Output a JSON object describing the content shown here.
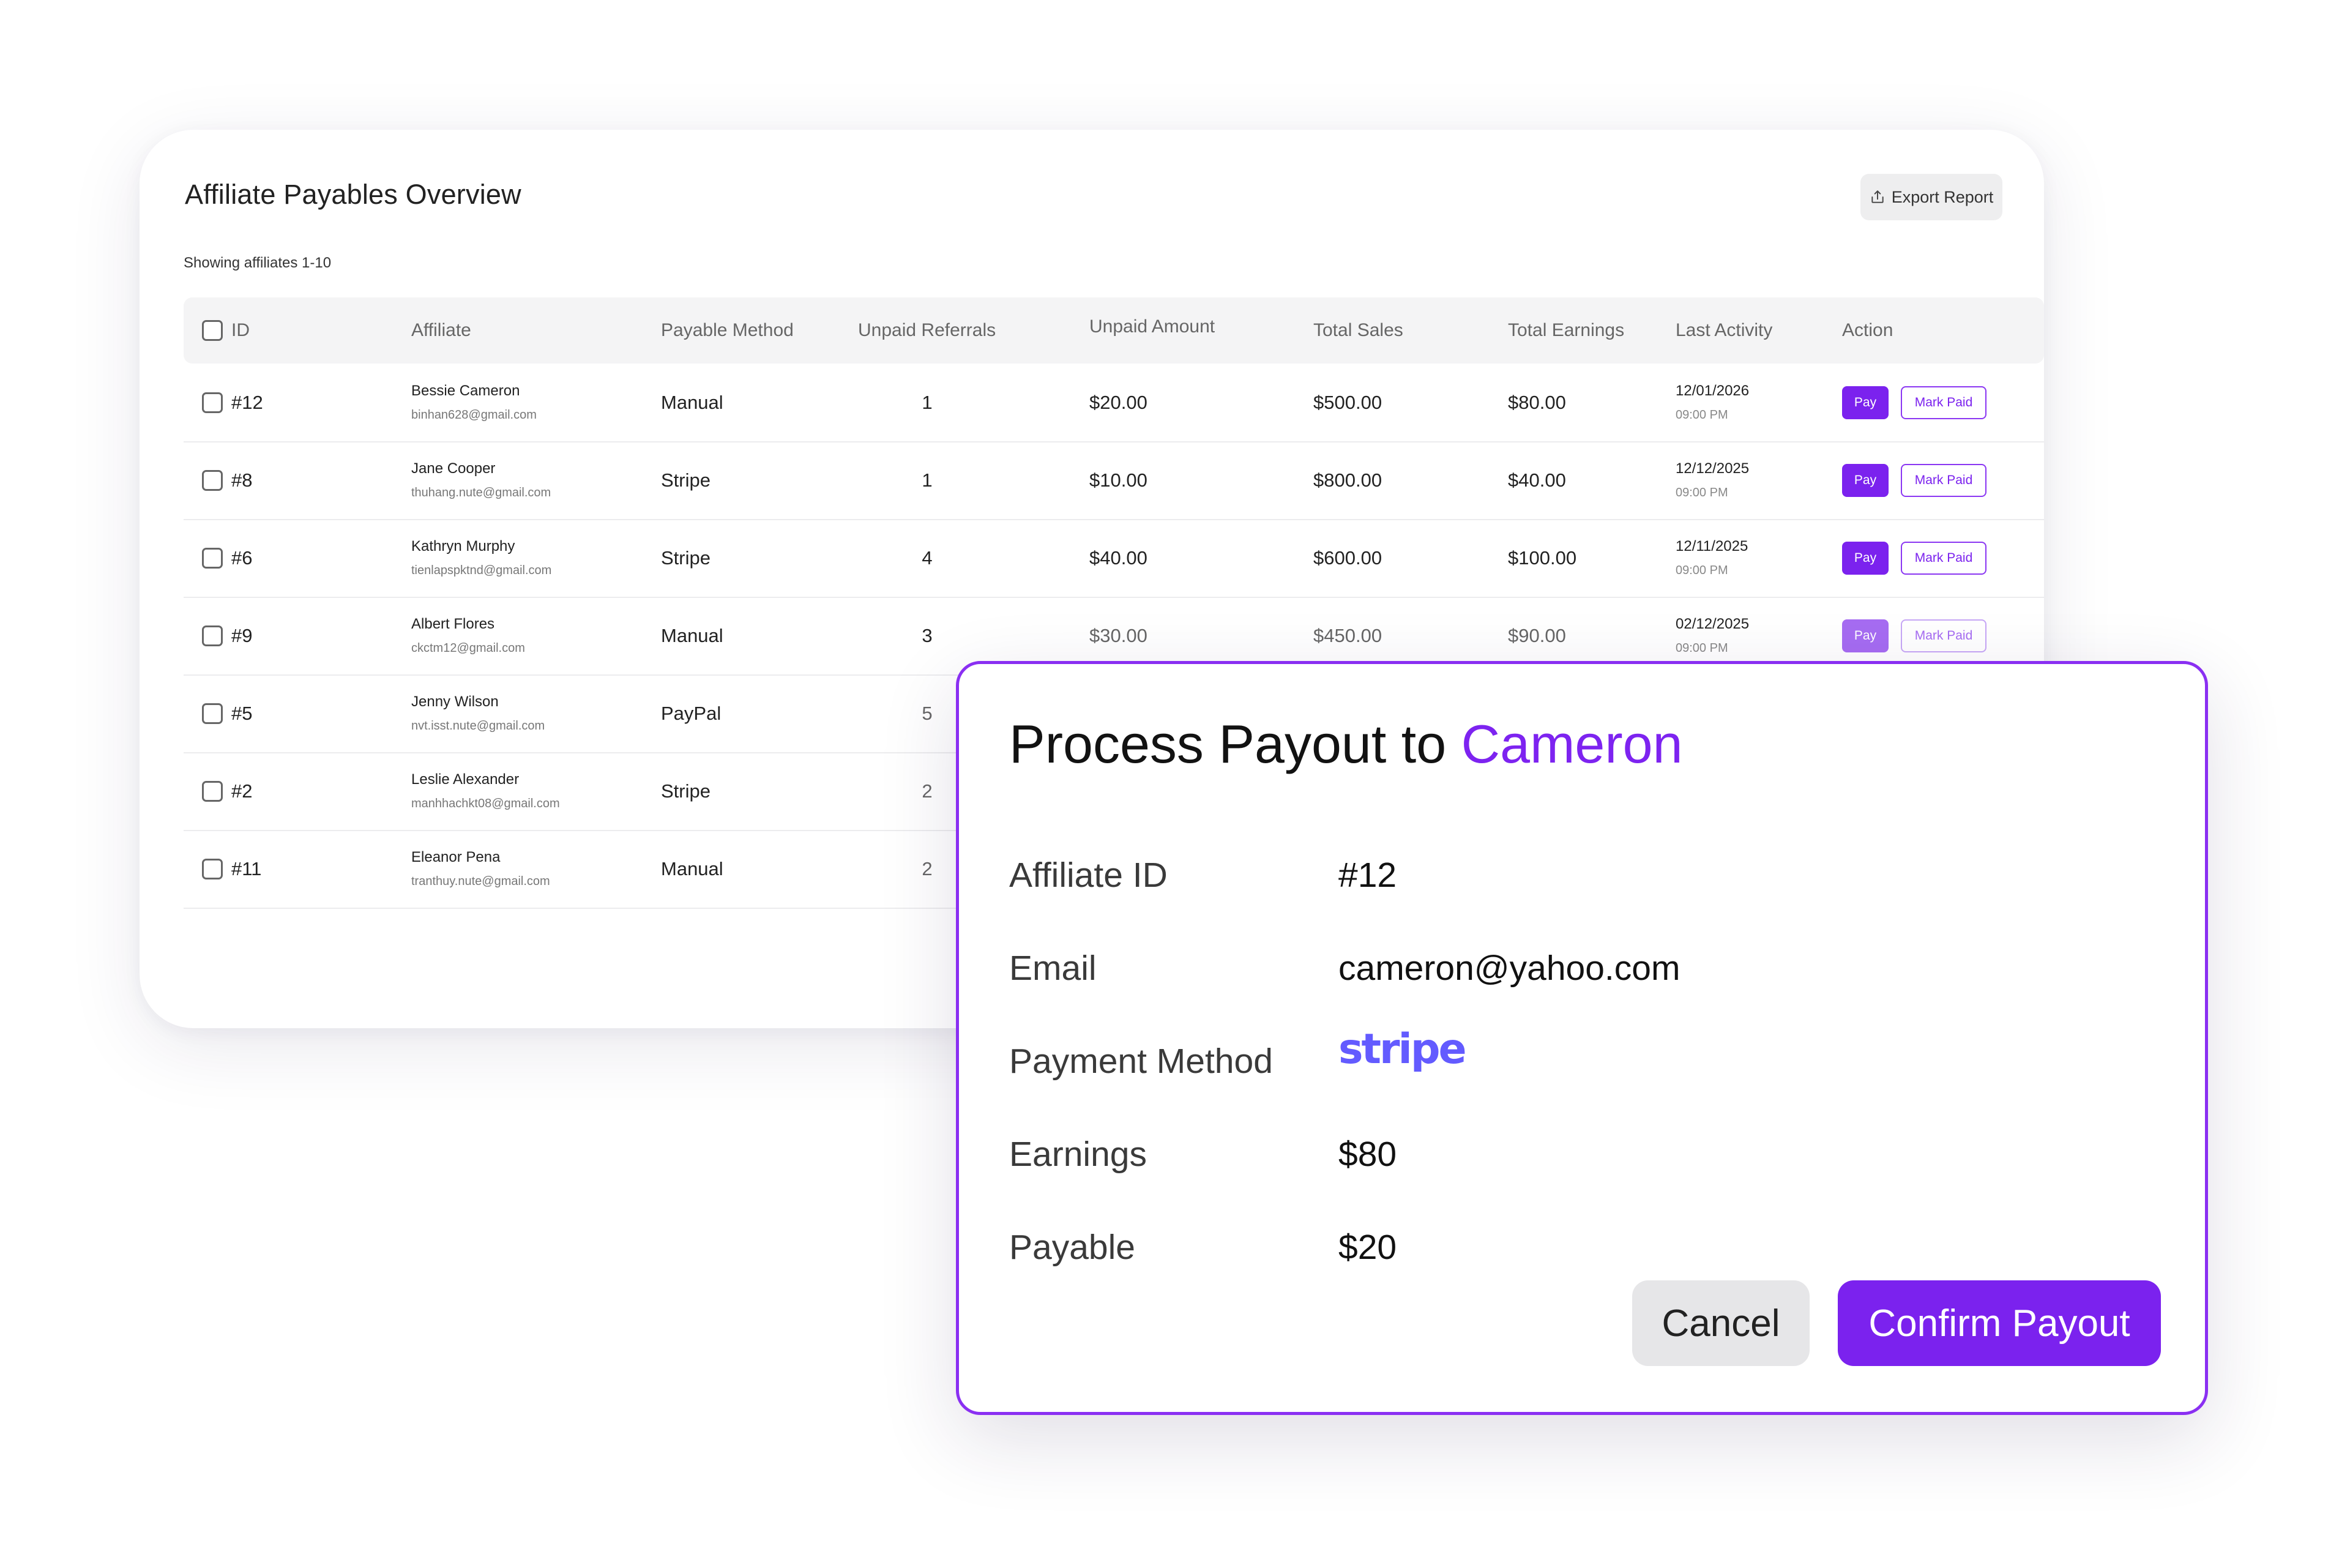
{
  "overview": {
    "title": "Affiliate Payables Overview",
    "export_label": "Export Report",
    "showing": "Showing affiliates 1-10"
  },
  "table": {
    "headers": {
      "id": "ID",
      "affiliate": "Affiliate",
      "method": "Payable Method",
      "referrals": "Unpaid Referrals",
      "amount": "Unpaid Amount",
      "sales": "Total Sales",
      "earnings": "Total Earnings",
      "activity": "Last Activity",
      "action": "Action"
    },
    "pay_label": "Pay",
    "mark_label": "Mark Paid",
    "rows": [
      {
        "id": "#12",
        "name": "Bessie Cameron",
        "email": "binhan628@gmail.com",
        "method": "Manual",
        "referrals": "1",
        "amount": "$20.00",
        "sales": "$500.00",
        "earnings": "$80.00",
        "date": "12/01/2026",
        "time": "09:00 PM"
      },
      {
        "id": "#8",
        "name": "Jane Cooper",
        "email": "thuhang.nute@gmail.com",
        "method": "Stripe",
        "referrals": "1",
        "amount": "$10.00",
        "sales": "$800.00",
        "earnings": "$40.00",
        "date": "12/12/2025",
        "time": "09:00 PM"
      },
      {
        "id": "#6",
        "name": "Kathryn Murphy",
        "email": "tienlapspktnd@gmail.com",
        "method": "Stripe",
        "referrals": "4",
        "amount": "$40.00",
        "sales": "$600.00",
        "earnings": "$100.00",
        "date": "12/11/2025",
        "time": "09:00 PM"
      },
      {
        "id": "#9",
        "name": "Albert Flores",
        "email": "ckctm12@gmail.com",
        "method": "Manual",
        "referrals": "3",
        "amount": "$30.00",
        "sales": "$450.00",
        "earnings": "$90.00",
        "date": "02/12/2025",
        "time": "09:00 PM"
      },
      {
        "id": "#5",
        "name": "Jenny Wilson",
        "email": "nvt.isst.nute@gmail.com",
        "method": "PayPal",
        "referrals": "5"
      },
      {
        "id": "#2",
        "name": "Leslie Alexander",
        "email": "manhhachkt08@gmail.com",
        "method": "Stripe",
        "referrals": "2"
      },
      {
        "id": "#11",
        "name": "Eleanor Pena",
        "email": "tranthuy.nute@gmail.com",
        "method": "Manual",
        "referrals": "2"
      }
    ]
  },
  "modal": {
    "title_prefix": "Process Payout to ",
    "title_name": "Cameron",
    "fields": {
      "affiliate_id_label": "Affiliate ID",
      "affiliate_id": "#12",
      "email_label": "Email",
      "email": "cameron@yahoo.com",
      "method_label": "Payment Method",
      "method_logo": "stripe",
      "earnings_label": "Earnings",
      "earnings": "$80",
      "payable_label": "Payable",
      "payable": "$20"
    },
    "cancel_label": "Cancel",
    "confirm_label": "Confirm Payout"
  },
  "colors": {
    "accent": "#7b22ee",
    "stripe": "#635bff"
  }
}
